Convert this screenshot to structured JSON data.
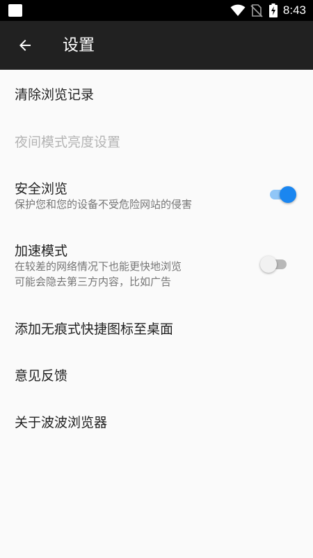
{
  "status_bar": {
    "time": "8:43",
    "icons": [
      "app-notification-icon",
      "wifi-icon",
      "no-sim-icon",
      "battery-charging-icon"
    ]
  },
  "app_bar": {
    "back_icon": "arrow-left-icon",
    "title": "设置"
  },
  "settings": {
    "clear_history": {
      "title": "清除浏览记录"
    },
    "night_brightness": {
      "title": "夜间模式亮度设置",
      "enabled": false
    },
    "safe_browsing": {
      "title": "安全浏览",
      "summary": "保护您和您的设备不受危险网站的侵害",
      "checked": true
    },
    "speed_mode": {
      "title": "加速模式",
      "summary_line1": "在较差的网络情况下也能更快地浏览",
      "summary_line2": "可能会隐去第三方内容，比如广告",
      "checked": false
    },
    "add_shortcut": {
      "title": "添加无痕式快捷图标至桌面"
    },
    "feedback": {
      "title": "意见反馈"
    },
    "about": {
      "title": "关于波波浏览器"
    }
  },
  "colors": {
    "status_bar_bg": "#000000",
    "app_bar_bg": "#212121",
    "page_bg": "#fafafa",
    "accent": "#1a86f0",
    "accent_track": "#90c6f7",
    "toggle_off_thumb": "#f1f1f1",
    "toggle_off_track": "#b8b8b8"
  }
}
